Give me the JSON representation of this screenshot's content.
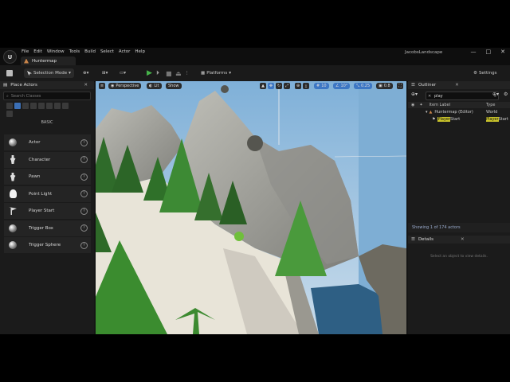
{
  "app": {
    "menu": [
      "File",
      "Edit",
      "Window",
      "Tools",
      "Build",
      "Select",
      "Actor",
      "Help"
    ],
    "map_tab": "Huntermap",
    "project_name": "JacobsLandscape",
    "window_controls": [
      "—",
      "□",
      "✕"
    ]
  },
  "toolbar": {
    "selection_mode": "Selection Mode",
    "platforms": "Platforms",
    "settings": "Settings"
  },
  "place_actors": {
    "tab_label": "Place Actors",
    "search_placeholder": "Search Classes",
    "category": "BASIC",
    "items": [
      {
        "label": "Actor",
        "icon": "sphere-icon"
      },
      {
        "label": "Character",
        "icon": "person-icon"
      },
      {
        "label": "Pawn",
        "icon": "person-icon"
      },
      {
        "label": "Point Light",
        "icon": "lightbulb-icon"
      },
      {
        "label": "Player Start",
        "icon": "flag-icon"
      },
      {
        "label": "Trigger Box",
        "icon": "sphere-icon"
      },
      {
        "label": "Trigger Sphere",
        "icon": "sphere-icon"
      }
    ]
  },
  "viewport": {
    "perspective": "Perspective",
    "lit": "Lit",
    "show": "Show",
    "grid_snap": "10",
    "rot_snap": "10°",
    "scale_snap": "0.25",
    "cam_speed": "0.8"
  },
  "outliner": {
    "tab_label": "Outliner",
    "search_value": "play",
    "col_label": "Item Label",
    "col_type": "Type",
    "rows": [
      {
        "label": "Huntermap (Editor)",
        "type": "World"
      },
      {
        "label_hl": "Player",
        "label_rest": "Start",
        "type_hl": "Player",
        "type_rest": "Start"
      }
    ],
    "status": "Showing 1 of 174 actors"
  },
  "details": {
    "tab_label": "Details",
    "empty_text": "Select an object to view details."
  }
}
